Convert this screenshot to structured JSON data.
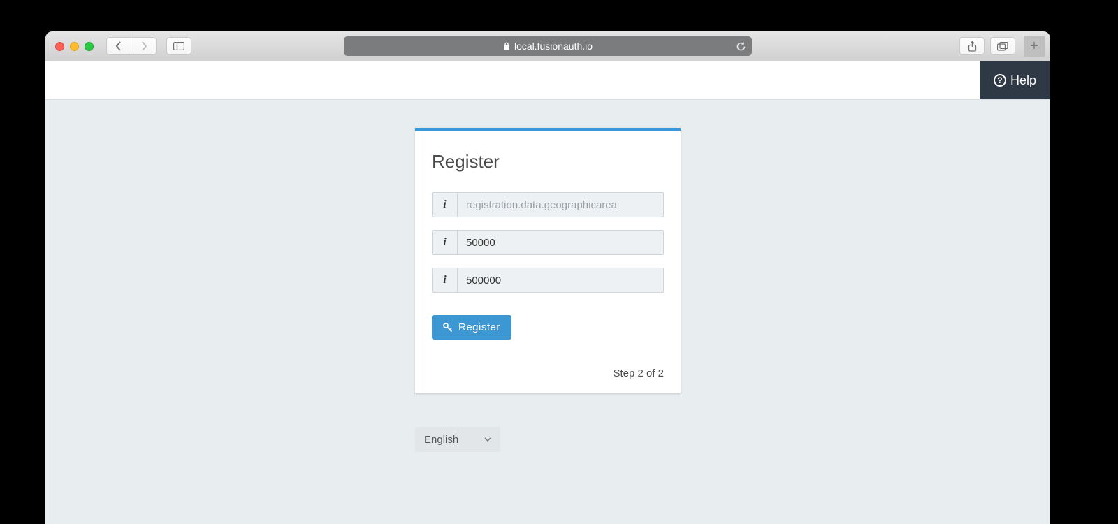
{
  "browser": {
    "url_host": "local.fusionauth.io"
  },
  "header": {
    "help_label": "Help"
  },
  "card": {
    "title": "Register",
    "fields": {
      "geo_placeholder": "registration.data.geographicarea",
      "min_value": "50000",
      "max_value": "500000"
    },
    "submit_label": "Register",
    "step_label": "Step 2 of 2"
  },
  "language": {
    "selected": "English"
  }
}
